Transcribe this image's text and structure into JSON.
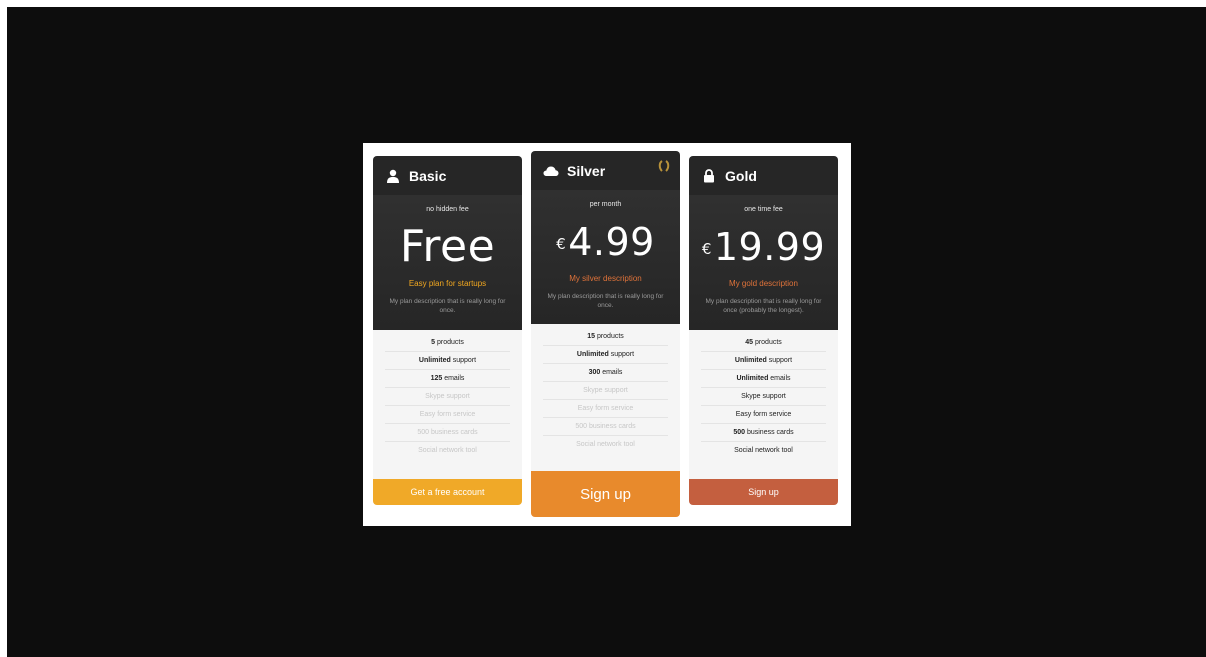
{
  "plans": [
    {
      "name": "Basic",
      "icon": "user-icon",
      "period": "no hidden fee",
      "currency": "",
      "price": "Free",
      "tagline": "Easy plan for startups",
      "description": "My plan description that is really long for once.",
      "features": [
        {
          "bold": "5",
          "text": " products",
          "enabled": true
        },
        {
          "bold": "Unlimited",
          "text": " support",
          "enabled": true
        },
        {
          "bold": "125",
          "text": " emails",
          "enabled": true
        },
        {
          "bold": "",
          "text": "Skype support",
          "enabled": false
        },
        {
          "bold": "",
          "text": "Easy form service",
          "enabled": false
        },
        {
          "bold": "",
          "text": "500 business cards",
          "enabled": false
        },
        {
          "bold": "",
          "text": "Social network tool",
          "enabled": false
        }
      ],
      "cta": "Get a free account",
      "cta_color": "#f0a928"
    },
    {
      "name": "Silver",
      "icon": "cloud-icon",
      "badge_icon": "laurel-icon",
      "period": "per month",
      "currency": "€",
      "price": "4.99",
      "tagline": "My silver description",
      "description": "My plan description that is really long for once.",
      "features": [
        {
          "bold": "15",
          "text": " products",
          "enabled": true
        },
        {
          "bold": "Unlimited",
          "text": " support",
          "enabled": true
        },
        {
          "bold": "300",
          "text": " emails",
          "enabled": true
        },
        {
          "bold": "",
          "text": "Skype support",
          "enabled": false
        },
        {
          "bold": "",
          "text": "Easy form service",
          "enabled": false
        },
        {
          "bold": "",
          "text": "500 business cards",
          "enabled": false
        },
        {
          "bold": "",
          "text": "Social network tool",
          "enabled": false
        }
      ],
      "cta": "Sign up",
      "cta_color": "#e88a2c"
    },
    {
      "name": "Gold",
      "icon": "lock-icon",
      "period": "one time fee",
      "currency": "€",
      "price": "19.99",
      "tagline": "My gold description",
      "description": "My plan description that is really long for once (probably the longest).",
      "features": [
        {
          "bold": "45",
          "text": " products",
          "enabled": true
        },
        {
          "bold": "Unlimited",
          "text": " support",
          "enabled": true
        },
        {
          "bold": "Unlimited",
          "text": " emails",
          "enabled": true
        },
        {
          "bold": "",
          "text": "Skype support",
          "enabled": true
        },
        {
          "bold": "",
          "text": "Easy form service",
          "enabled": true
        },
        {
          "bold": "500",
          "text": " business cards",
          "enabled": true
        },
        {
          "bold": "",
          "text": "Social network tool",
          "enabled": true
        }
      ],
      "cta": "Sign up",
      "cta_color": "#c45f3f"
    }
  ]
}
